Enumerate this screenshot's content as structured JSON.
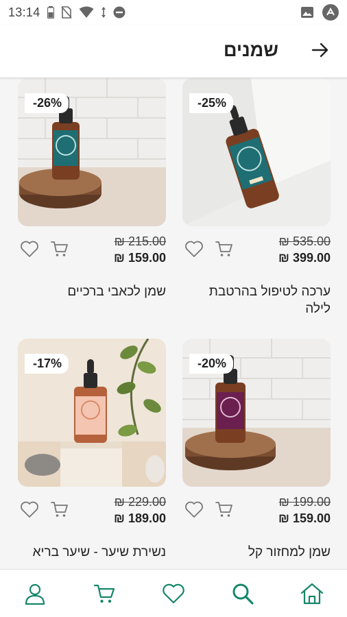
{
  "status_bar": {
    "time": "13:14"
  },
  "header": {
    "title": "שמנים"
  },
  "colors": {
    "accent": "#16866a",
    "card_background": "#f5f5f5"
  },
  "products": [
    {
      "discount": "-25%",
      "old_price": "535.00 ₪",
      "new_price": "399.00 ₪",
      "name": "ערכה לטיפול בהרטבת לילה",
      "image": "teal dropper bottle in white corner"
    },
    {
      "discount": "-26%",
      "old_price": "215.00 ₪",
      "new_price": "159.00 ₪",
      "name": "שמן לכאבי ברכיים",
      "image": "teal dropper bottle on wood slice"
    },
    {
      "discount": "-20%",
      "old_price": "199.00 ₪",
      "new_price": "159.00 ₪",
      "name": "שמן למחזור קל",
      "image": "purple dropper bottle on wood slice"
    },
    {
      "discount": "-17%",
      "old_price": "229.00 ₪",
      "new_price": "189.00 ₪",
      "name": "נשירת שיער - שיער בריא",
      "image": "salmon hair oil bottle with plant"
    }
  ],
  "bottom_nav": {
    "items": [
      {
        "name": "profile",
        "icon": "user-icon"
      },
      {
        "name": "cart",
        "icon": "cart-icon"
      },
      {
        "name": "favorites",
        "icon": "heart-icon"
      },
      {
        "name": "search",
        "icon": "search-icon"
      },
      {
        "name": "home",
        "icon": "home-icon"
      }
    ]
  }
}
